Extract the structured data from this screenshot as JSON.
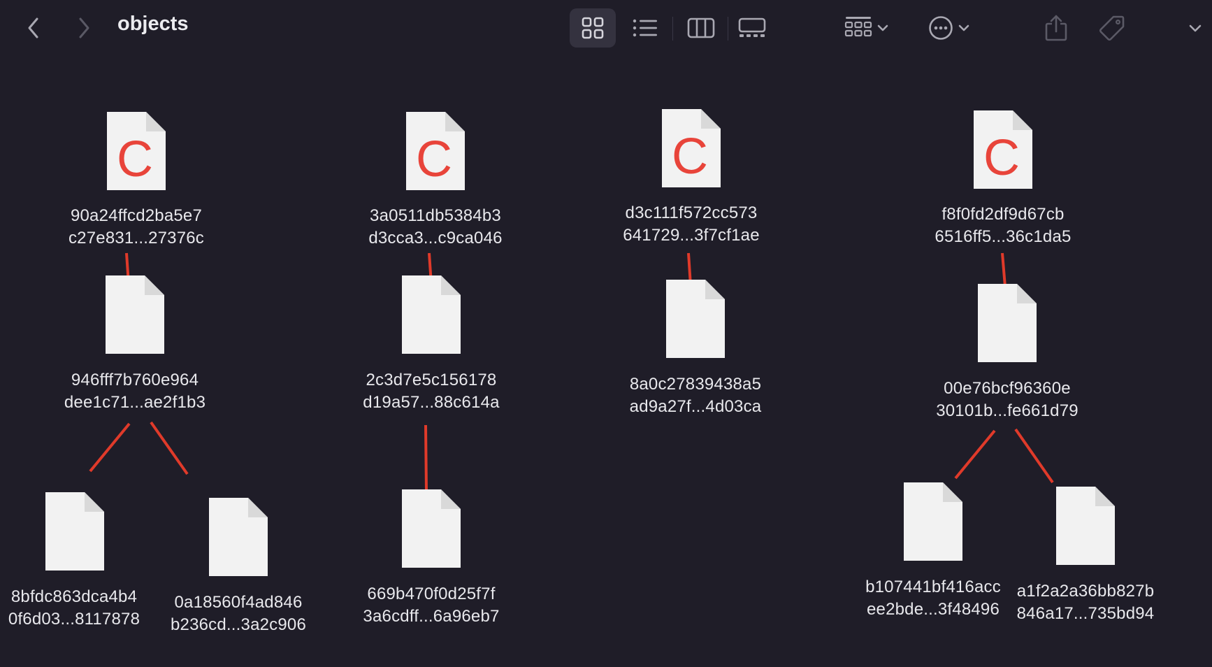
{
  "window": {
    "title": "objects"
  },
  "toolbar": {
    "back_icon": "chevron-left-icon",
    "forward_icon": "chevron-right-icon",
    "views": [
      "icon-view",
      "list-view",
      "column-view",
      "gallery-view"
    ],
    "selected_view": "icon-view",
    "group_icon": "group-grid-icon",
    "action_icon": "ellipsis-circle-icon",
    "share_icon": "share-icon",
    "tag_icon": "tag-icon",
    "overflow_icon": "chevron-down-icon"
  },
  "files": [
    {
      "line1": "90a24ffcd2ba5e7",
      "line2": "c27e831...27376c",
      "kind": "c-source"
    },
    {
      "line1": "3a0511db5384b3",
      "line2": "d3cca3...c9ca046",
      "kind": "c-source"
    },
    {
      "line1": "d3c111f572cc573",
      "line2": "641729...3f7cf1ae",
      "kind": "c-source"
    },
    {
      "line1": "f8f0fd2df9d67cb",
      "line2": "6516ff5...36c1da5",
      "kind": "c-source"
    },
    {
      "line1": "946fff7b760e964",
      "line2": "dee1c71...ae2f1b3",
      "kind": "blank"
    },
    {
      "line1": "2c3d7e5c156178",
      "line2": "d19a57...88c614a",
      "kind": "blank"
    },
    {
      "line1": "8a0c27839438a5",
      "line2": "ad9a27f...4d03ca",
      "kind": "blank"
    },
    {
      "line1": "00e76bcf96360e",
      "line2": "30101b...fe661d79",
      "kind": "blank"
    },
    {
      "line1": "8bfdc863dca4b4",
      "line2": "0f6d03...8117878",
      "kind": "blank"
    },
    {
      "line1": "0a18560f4ad846",
      "line2": "b236cd...3a2c906",
      "kind": "blank"
    },
    {
      "line1": "669b470f0d25f7f",
      "line2": "3a6cdff...6a96eb7",
      "kind": "blank"
    },
    {
      "line1": "b107441bf416acc",
      "line2": "ee2bde...3f48496",
      "kind": "blank"
    },
    {
      "line1": "a1f2a2a36bb827b",
      "line2": "846a17...735bd94",
      "kind": "blank"
    }
  ],
  "c_badge": "C",
  "colors": {
    "background": "#1f1d28",
    "annotation_line": "#e03a2a",
    "c_letter": "#e8443a",
    "document": "#f2f2f2"
  }
}
